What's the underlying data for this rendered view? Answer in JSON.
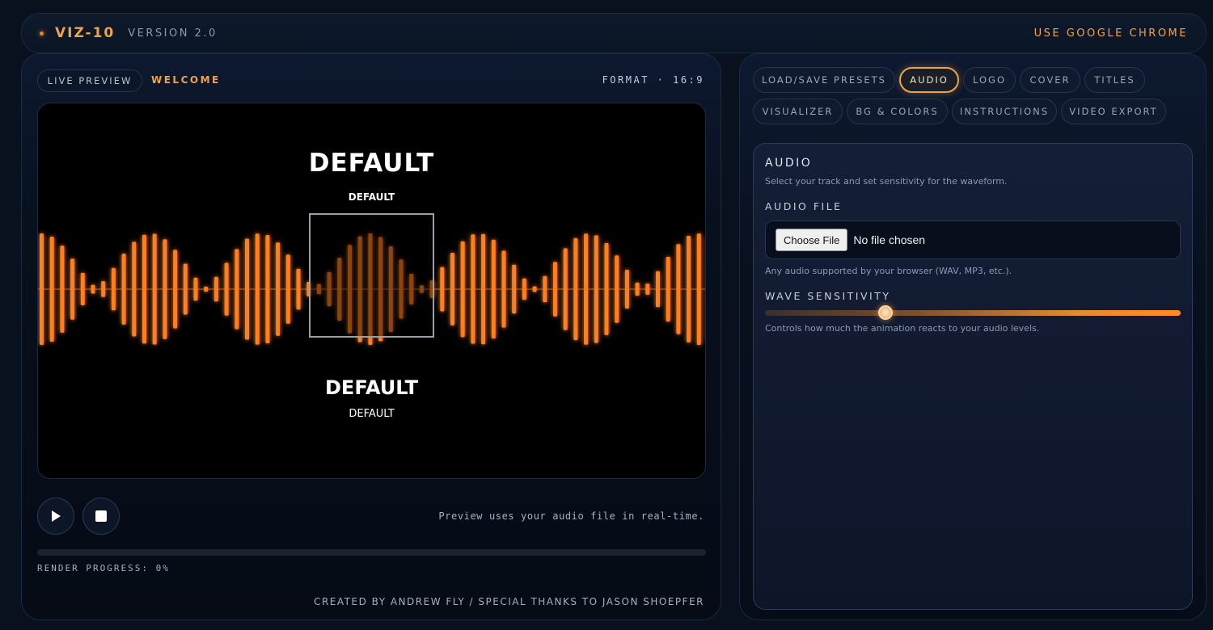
{
  "header": {
    "brand": "VIZ-10",
    "version": "VERSION 2.0",
    "browser_note": "USE GOOGLE CHROME",
    "accent_color": "#f0a24a"
  },
  "preview": {
    "live_label": "LIVE PREVIEW",
    "welcome_label": "WELCOME",
    "format_label": "FORMAT · 16:9",
    "title_main": "DEFAULT",
    "title_small": "DEFAULT",
    "subtitle_main": "DEFAULT",
    "subtitle_small": "DEFAULT",
    "wave_color": "#ff7f1f",
    "hint": "Preview uses your audio file in real-time.",
    "render_progress_label": "RENDER PROGRESS: 0%",
    "render_progress": 0,
    "credits": "CREATED BY ANDREW FLY / SPECIAL THANKS TO JASON SHOEPFER"
  },
  "controls": {
    "play_icon": "play-icon",
    "stop_icon": "stop-icon"
  },
  "tabs": [
    {
      "label": "LOAD/SAVE PRESETS",
      "active": false
    },
    {
      "label": "AUDIO",
      "active": true
    },
    {
      "label": "LOGO",
      "active": false
    },
    {
      "label": "COVER",
      "active": false
    },
    {
      "label": "TITLES",
      "active": false
    },
    {
      "label": "VISUALIZER",
      "active": false
    },
    {
      "label": "BG & COLORS",
      "active": false
    },
    {
      "label": "INSTRUCTIONS",
      "active": false
    },
    {
      "label": "VIDEO EXPORT",
      "active": false
    }
  ],
  "audio_card": {
    "title": "AUDIO",
    "subtitle": "Select your track and set sensitivity for the waveform.",
    "file_label": "AUDIO FILE",
    "choose_button": "Choose File",
    "file_status": "No file chosen",
    "file_note": "Any audio supported by your browser (WAV, MP3, etc.).",
    "sensitivity_label": "WAVE SENSITIVITY",
    "sensitivity_value": 0.29,
    "sensitivity_note": "Controls how much the animation reacts to your audio levels."
  }
}
